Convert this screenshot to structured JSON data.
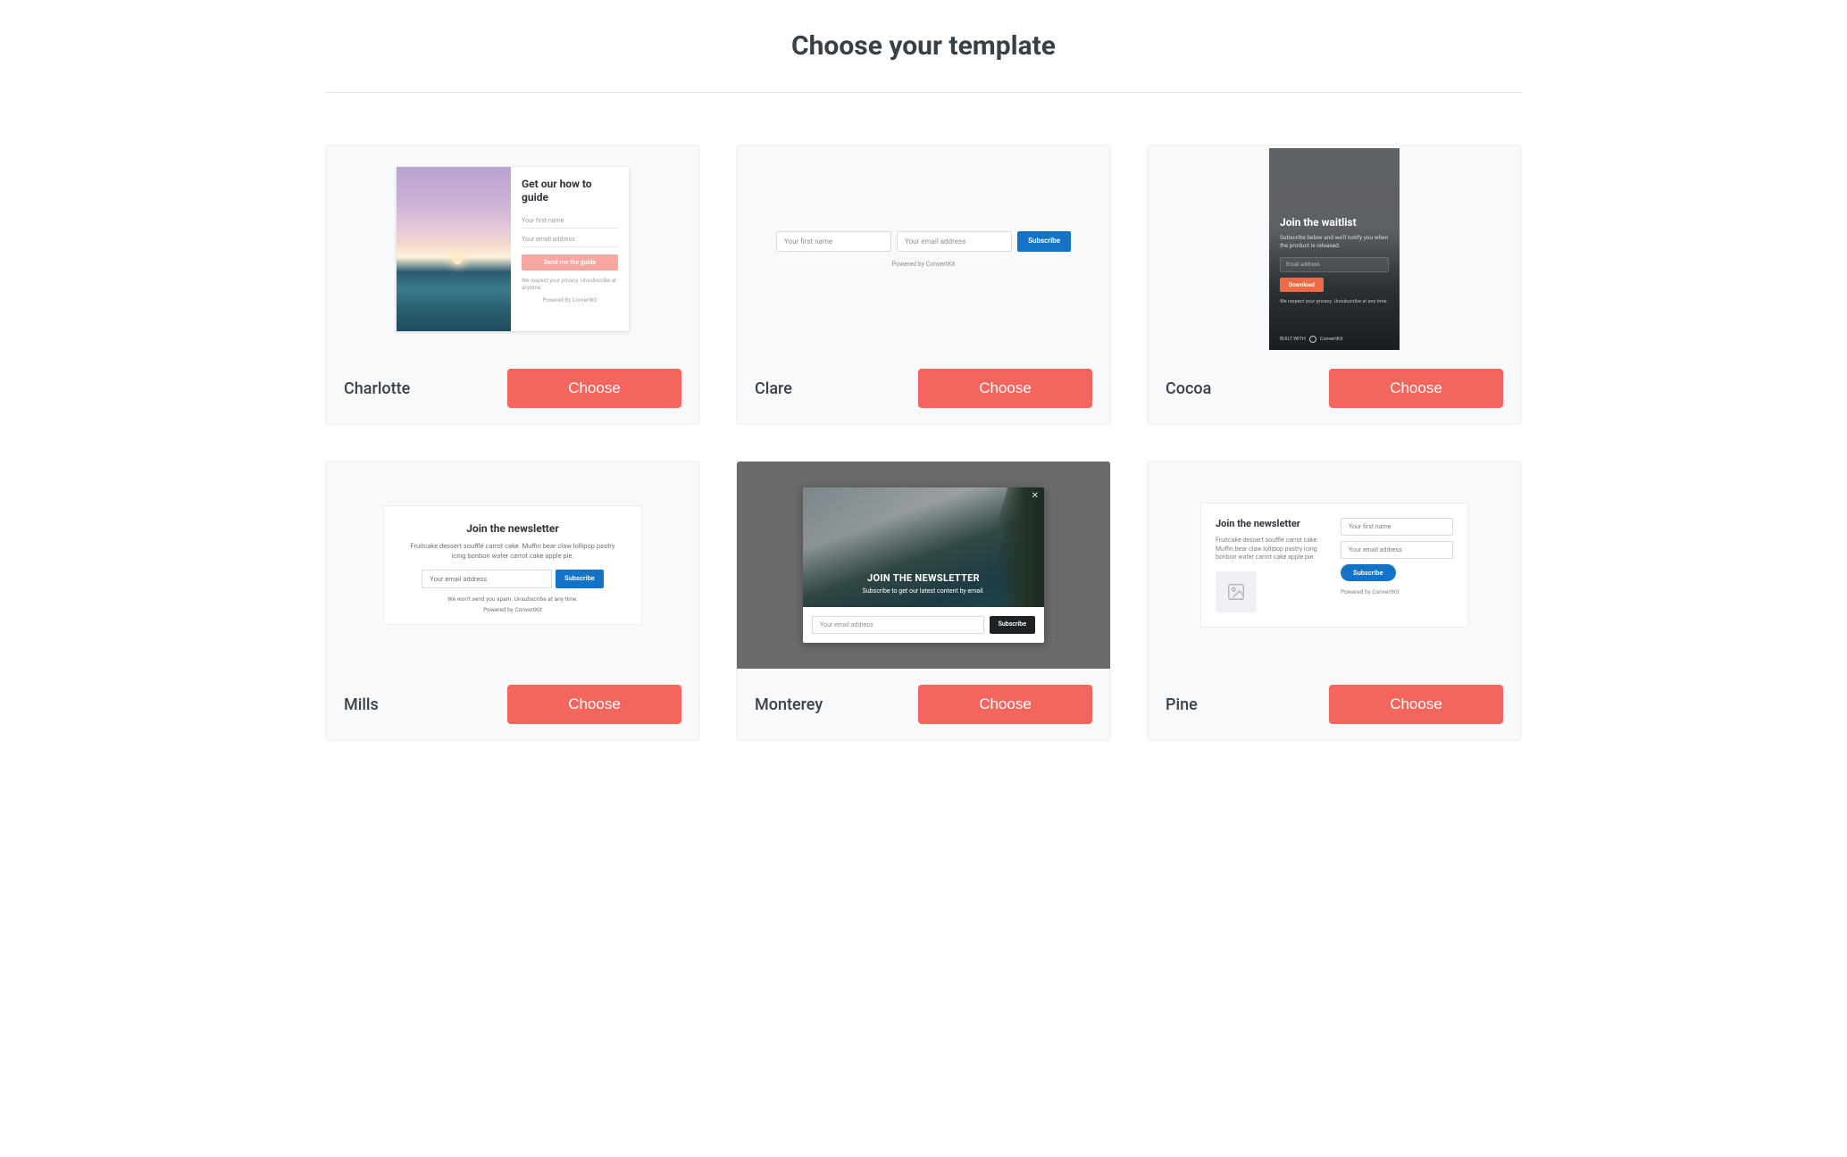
{
  "page_title": "Choose your template",
  "choose_label": "Choose",
  "templates": [
    {
      "name": "Charlotte"
    },
    {
      "name": "Clare"
    },
    {
      "name": "Cocoa"
    },
    {
      "name": "Mills"
    },
    {
      "name": "Monterey"
    },
    {
      "name": "Pine"
    }
  ],
  "previews": {
    "charlotte": {
      "heading": "Get our how to guide",
      "first_name_ph": "Your first name",
      "email_ph": "Your email address",
      "button": "Send me the guide",
      "note": "We respect your privacy. Unsubscribe at anytime.",
      "powered": "Powered By ConvertKit"
    },
    "clare": {
      "first_name_ph": "Your first name",
      "email_ph": "Your email address",
      "button": "Subscribe",
      "powered": "Powered by ConvertKit"
    },
    "cocoa": {
      "heading": "Join the waitlist",
      "sub": "Subscribe below and we'll notify you when the product is released.",
      "email_ph": "Email address",
      "button": "Download",
      "note": "We respect your privacy. Unsubscribe at any time.",
      "built_with": "BUILT WITH",
      "brand": "ConvertKit"
    },
    "mills": {
      "heading": "Join the newsletter",
      "desc": "Fruitcake dessert soufflé carrot cake. Muffin bear claw lollipop pastry icing bonbon wafer carrot cake apple pie.",
      "email_ph": "Your email address",
      "button": "Subscribe",
      "note": "We won't send you spam. Unsubscribe at any time.",
      "powered": "Powered by ConvertKit"
    },
    "monterey": {
      "heading": "JOIN THE NEWSLETTER",
      "sub": "Subscribe to get our latest content by email.",
      "email_ph": "Your email address",
      "button": "Subscribe"
    },
    "pine": {
      "heading": "Join the newsletter",
      "desc": "Fruitcake dessert soufflé carrot cake. Muffin bear claw lollipop pastry icing bonbon wafer carrot cake apple pie.",
      "first_name_ph": "Your first name",
      "email_ph": "Your email address",
      "button": "Subscribe",
      "powered": "Powered by ConvertKit"
    }
  }
}
